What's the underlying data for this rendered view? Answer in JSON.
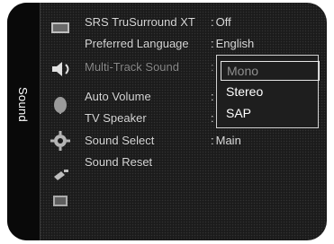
{
  "sidebar": {
    "title": "Sound",
    "icons": [
      "tv-picture-icon",
      "sound-speaker-icon",
      "channel-satellite-icon",
      "setup-gear-icon",
      "input-plug-icon",
      "application-icon"
    ]
  },
  "menu": {
    "items": [
      {
        "label": "SRS TruSurround XT",
        "value": "Off"
      },
      {
        "label": "Preferred Language",
        "value": "English"
      },
      {
        "label": "Multi-Track Sound",
        "value": ""
      },
      {
        "label": "Auto Volume",
        "value": ""
      },
      {
        "label": "TV Speaker",
        "value": ""
      },
      {
        "label": "Sound Select",
        "value": "Main"
      },
      {
        "label": "Sound Reset",
        "value": ""
      }
    ],
    "separator": ":"
  },
  "dropdown": {
    "options": [
      "Mono",
      "Stereo",
      "SAP"
    ],
    "selected": "Mono"
  }
}
